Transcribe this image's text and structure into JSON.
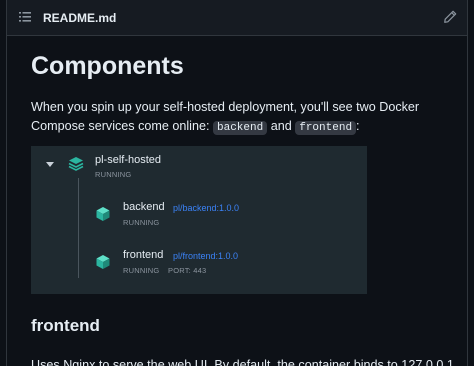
{
  "header": {
    "file_title": "README.md"
  },
  "doc": {
    "heading": "Components",
    "intro_text": "When you spin up your self-hosted deployment, you'll see two Docker Compose services come online:",
    "code_backend": "backend",
    "and_text": "and",
    "code_frontend": "frontend",
    "colon": ":",
    "subheading": "frontend",
    "frontend_text": "Uses Nginx to serve the web UI. By default, the container binds to 127.0.0.1"
  },
  "compose": {
    "project": {
      "name": "pl-self-hosted",
      "status": "RUNNING"
    },
    "services": [
      {
        "name": "backend",
        "image": "pl/backend:1.0.0",
        "status": "RUNNING",
        "port": ""
      },
      {
        "name": "frontend",
        "image": "pl/frontend:1.0.0",
        "status": "RUNNING",
        "port": "PORT: 443"
      }
    ]
  },
  "colors": {
    "accent_teal": "#2bb5a0",
    "link_blue": "#3b82f6",
    "panel_bg": "#1f2a30"
  },
  "icons": {
    "list": "list-icon",
    "edit": "pencil-icon",
    "stack": "stack-icon",
    "container": "container-cube-icon"
  }
}
